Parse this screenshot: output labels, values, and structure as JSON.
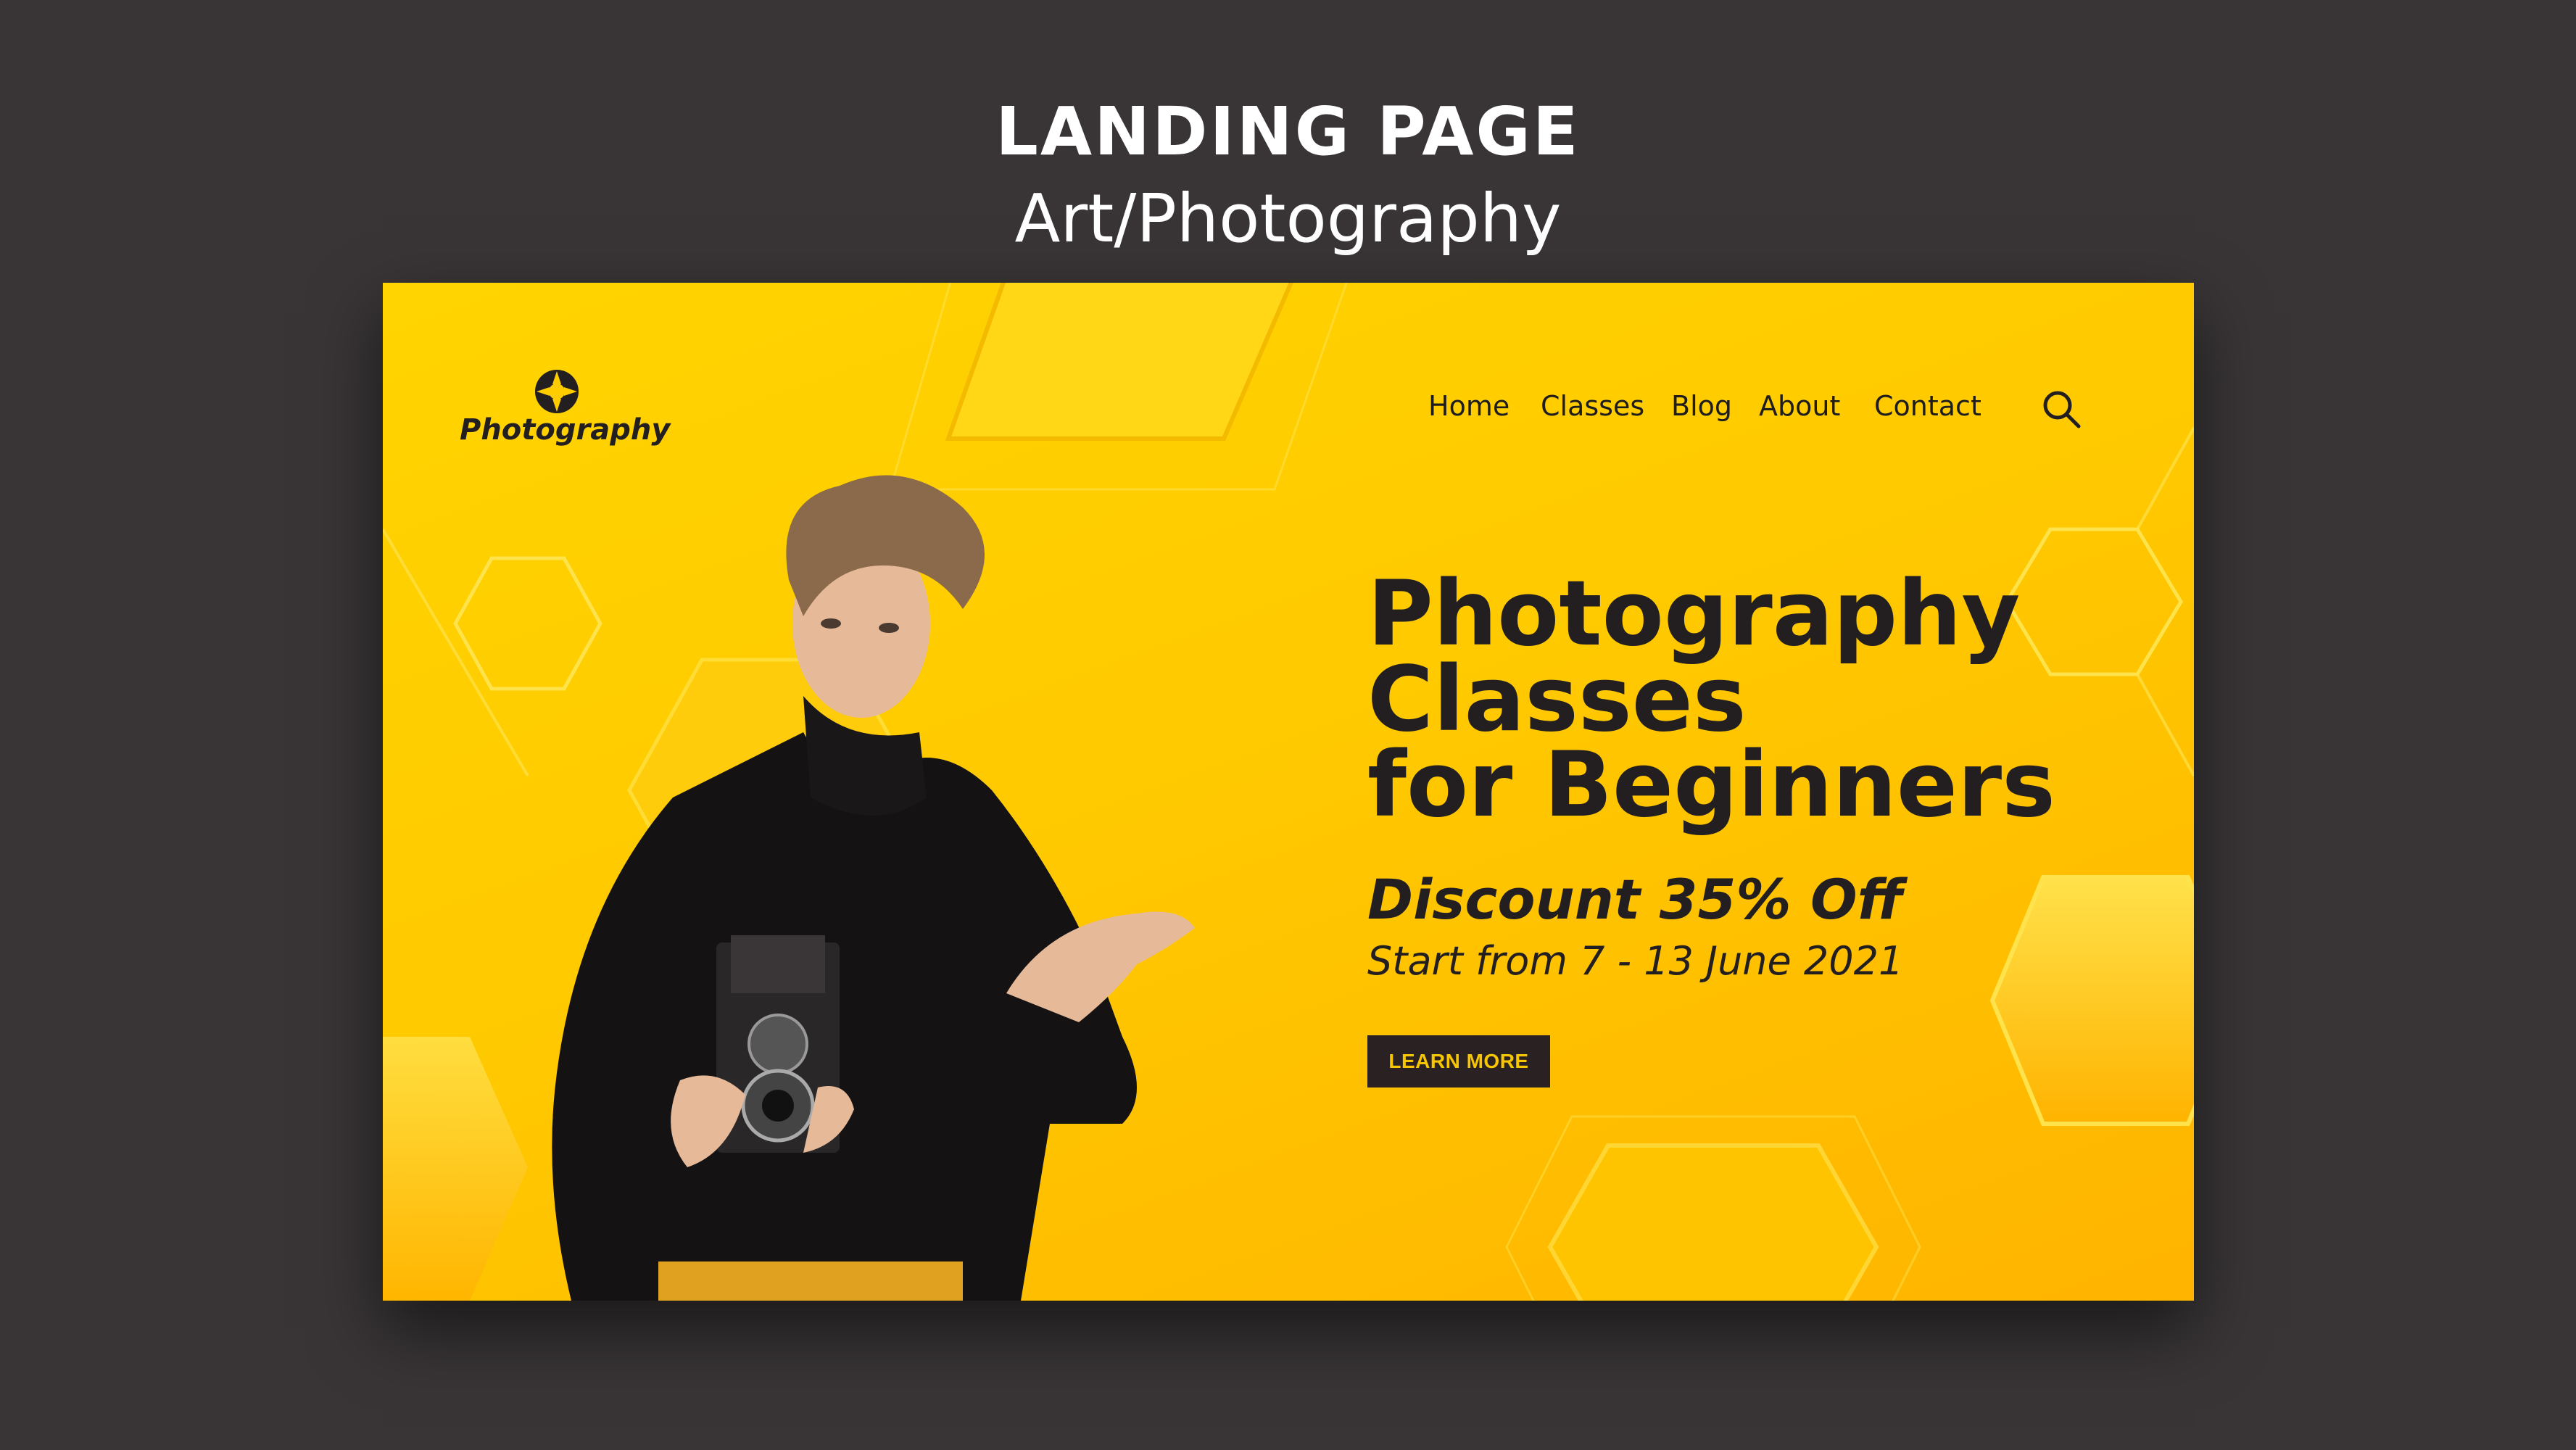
{
  "showcase": {
    "title": "LANDING PAGE",
    "subtitle": "Art/Photography"
  },
  "logo": {
    "text": "Photography",
    "icon": "camera-aperture-icon"
  },
  "nav": {
    "items": [
      {
        "label": "Home"
      },
      {
        "label": "Classes"
      },
      {
        "label": "Blog"
      },
      {
        "label": "About"
      },
      {
        "label": "Contact"
      }
    ],
    "search_icon": "search-icon"
  },
  "hero": {
    "title_lines": [
      "Photography",
      "Classes",
      "for Beginners"
    ],
    "discount": "Discount 35% Off",
    "dates": "Start from 7 - 13 June 2021",
    "cta_label": "LEARN MORE"
  },
  "colors": {
    "background": "#393536",
    "accent_yellow": "#ffcc00",
    "dark": "#231f20",
    "button_text": "#f7c600"
  }
}
